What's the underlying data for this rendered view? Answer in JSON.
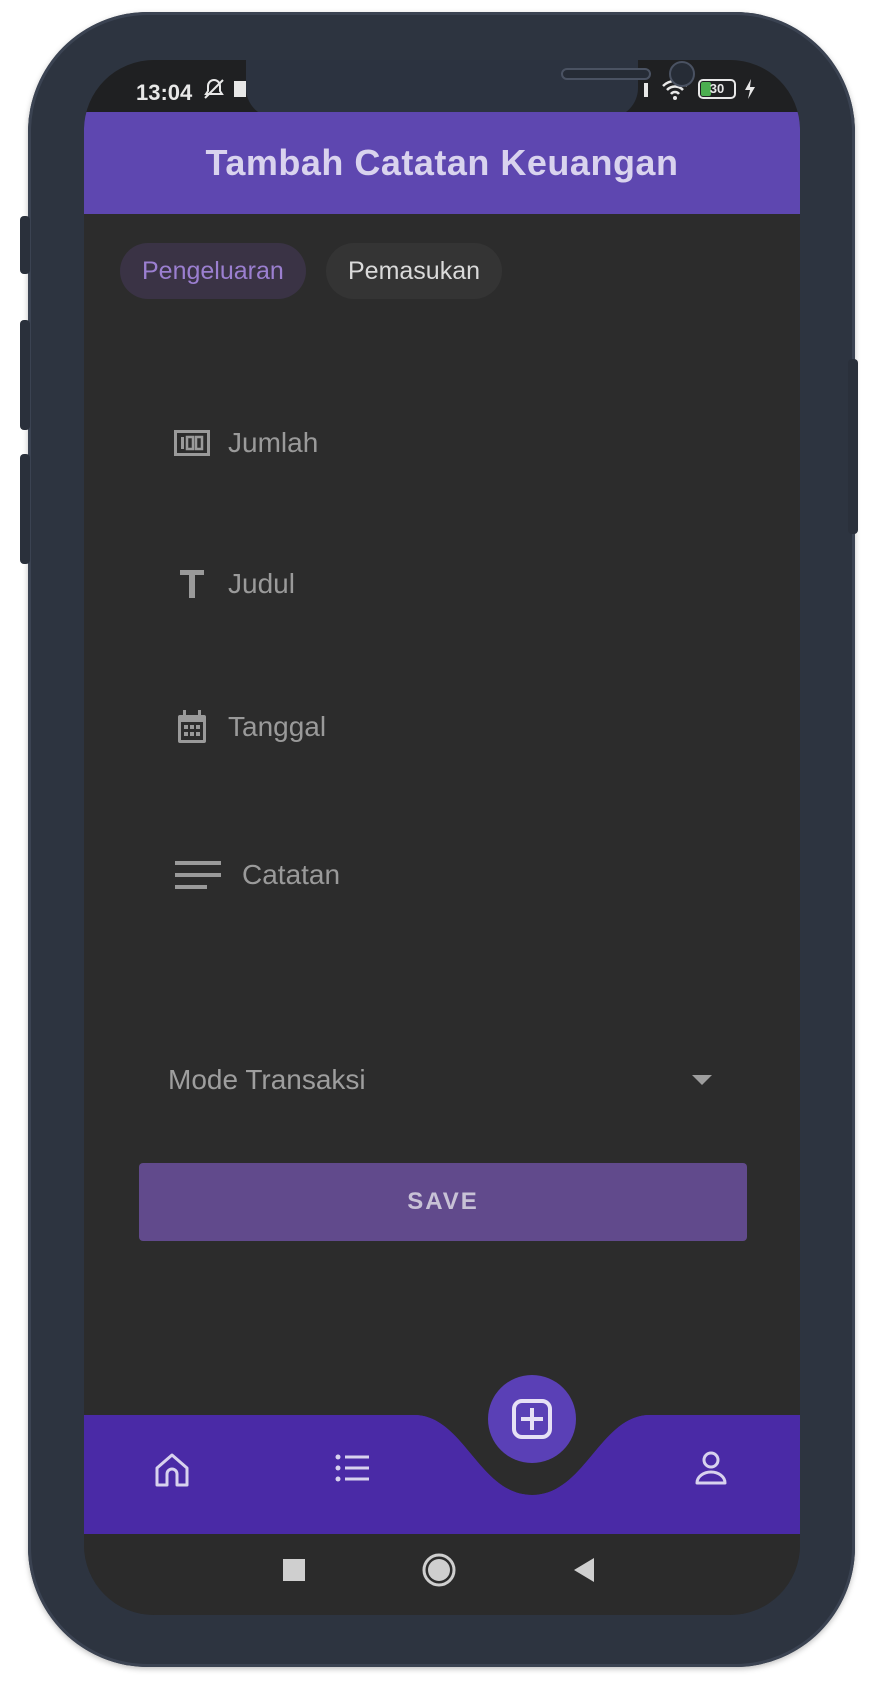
{
  "status_bar": {
    "time": "13:04",
    "battery_level": "30"
  },
  "app_bar": {
    "title": "Tambah Catatan Keuangan"
  },
  "tabs": [
    {
      "label": "Pengeluaran",
      "selected": true
    },
    {
      "label": "Pemasukan",
      "selected": false
    }
  ],
  "form": {
    "amount_placeholder": "Jumlah",
    "title_placeholder": "Judul",
    "date_placeholder": "Tanggal",
    "note_placeholder": "Catatan",
    "transaction_mode_placeholder": "Mode Transaksi"
  },
  "save_button": {
    "label": "SAVE"
  },
  "bottom_nav": {
    "items": [
      {
        "icon": "home-icon"
      },
      {
        "icon": "list-icon"
      },
      {
        "icon": "add-box-icon"
      },
      {
        "icon": "person-icon"
      }
    ]
  },
  "colors": {
    "app_bar": "#5e47b0",
    "bottom_nav": "#4a2aa6",
    "background": "#2c2c2c",
    "accent": "#9b7fd0",
    "save_button": "#614a8c"
  }
}
